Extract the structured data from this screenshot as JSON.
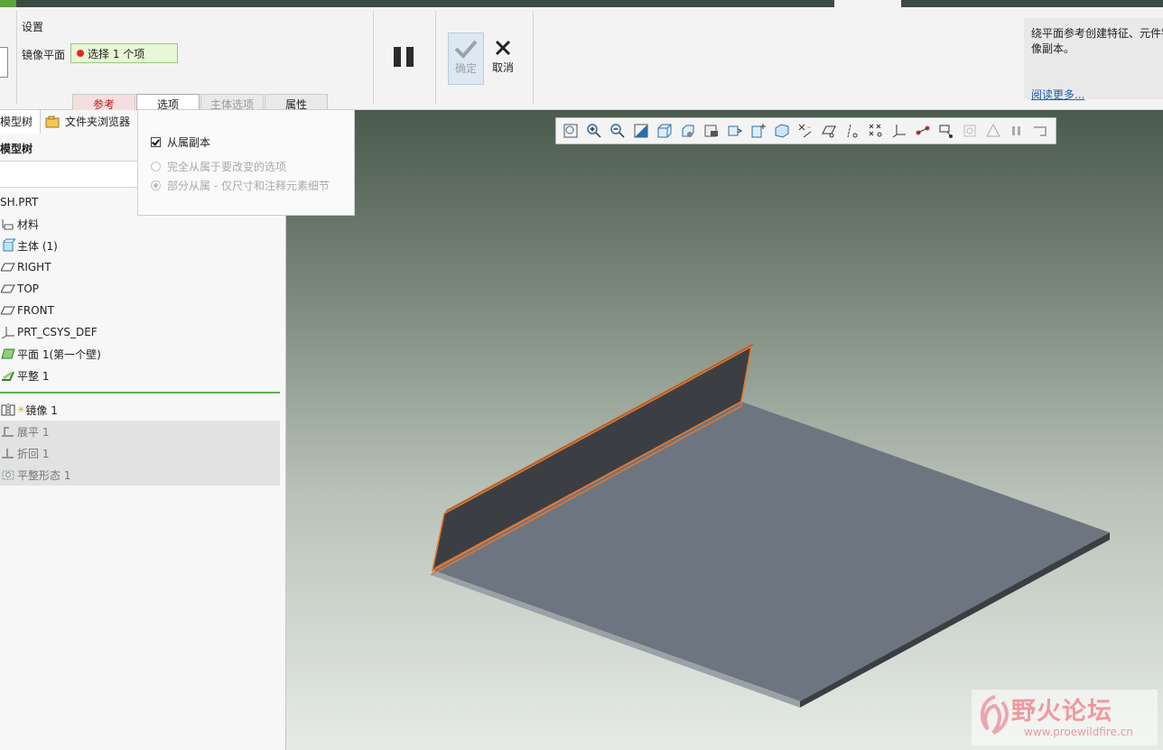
{
  "ribbon": {
    "settings_title": "设置",
    "mirror_plane_label": "镜像平面",
    "collector_text": "选择 1 个项",
    "ok_label": "确定",
    "cancel_label": "取消",
    "help_text": "绕平面参考创建特征、元件镜\n像副本。",
    "help_more": "阅读更多...",
    "tabs": [
      "参考",
      "选项",
      "主体选项",
      "属性"
    ]
  },
  "options_popup": {
    "dependent_copy": "从属副本",
    "dependent_checked": true,
    "full_dependent": "完全从属于要改变的选项",
    "partial_dependent": "部分从属 - 仅尺寸和注释元素细节"
  },
  "left_pane": {
    "tab_model_tree": "模型树",
    "tab_folder_browser": "文件夹浏览器",
    "tree_header": "模型树",
    "items": [
      {
        "label": "SH.PRT",
        "icon": "part-icon"
      },
      {
        "label": "材料",
        "icon": "material-icon"
      },
      {
        "label": "主体 (1)",
        "icon": "body-icon"
      },
      {
        "label": "RIGHT",
        "icon": "datum-plane-icon"
      },
      {
        "label": "TOP",
        "icon": "datum-plane-icon"
      },
      {
        "label": "FRONT",
        "icon": "datum-plane-icon"
      },
      {
        "label": "PRT_CSYS_DEF",
        "icon": "csys-icon"
      },
      {
        "label": "平面 1(第一个壁)",
        "icon": "planar-wall-icon"
      },
      {
        "label": "平整 1",
        "icon": "flat-wall-icon"
      }
    ],
    "after_insert": [
      {
        "label": "镜像 1",
        "icon": "mirror-icon"
      },
      {
        "label": "展平 1",
        "icon": "unbend-icon"
      },
      {
        "label": "折回 1",
        "icon": "bend-back-icon"
      },
      {
        "label": "平整形态 1",
        "icon": "flat-pattern-icon"
      }
    ]
  },
  "view_toolbar": {
    "icons": [
      "refit-icon",
      "zoom-in-icon",
      "zoom-out-icon",
      "repaint-icon",
      "display-style-icon",
      "saved-orientations-icon",
      "view-manager-icon",
      "perspective-icon",
      "spin-center-icon",
      "section-icon",
      "annotation-display-icon",
      "plane-display-icon",
      "axis-display-icon",
      "point-display-icon",
      "csys-display-icon",
      "spin-display-icon",
      "filter-icon",
      "feature-display-icon",
      "pause-icon",
      "appearance-icon"
    ]
  },
  "colors": {
    "accent_green": "#5aa63a",
    "selection_orange": "#e8772e",
    "sheet_gray": "#6d7680",
    "wall_dark": "#3b3f44"
  },
  "watermark": {
    "title": "野火论坛",
    "url": "www.proewildfire.cn"
  }
}
